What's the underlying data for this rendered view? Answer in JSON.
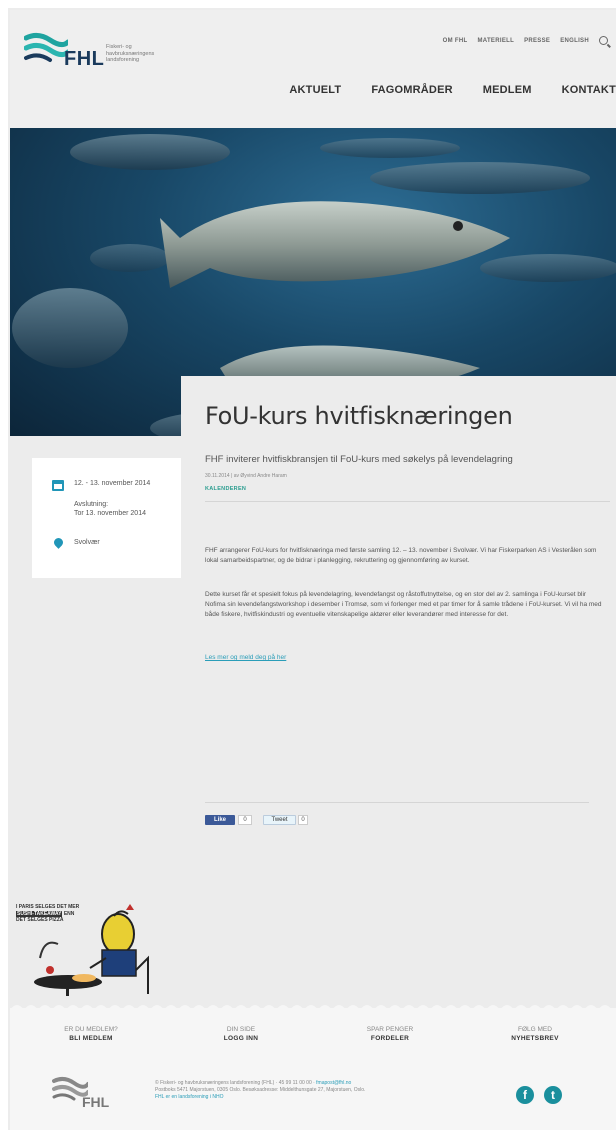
{
  "header": {
    "logo_word": "FHL",
    "logo_sub": "Fiskeri- og havbruksnæringens landsforening",
    "top_links": [
      "OM FHL",
      "MATERIELL",
      "PRESSE",
      "ENGLISH"
    ],
    "main_nav": [
      "AKTUELT",
      "FAGOMRÅDER",
      "MEDLEM",
      "KONTAKT"
    ]
  },
  "event": {
    "date": "12. - 13. november 2014",
    "deadline_label": "Avslutning:",
    "deadline_value": "Tor 13. november 2014",
    "place": "Svolvær"
  },
  "article": {
    "title": "FoU-kurs hvitfisknæringen",
    "lead": "FHF inviterer hvitfiskbransjen til FoU-kurs med søkelys på levendelagring",
    "meta": "30.11.2014 | av Øyvind Andre Haram",
    "category": "KALENDEREN",
    "p1": "FHF arrangerer FoU-kurs for hvitfisknæringa med første samling 12. – 13. november i Svolvær. Vi har Fiskerparken AS i Vesterålen som lokal samarbeidspartner, og de bidrar i planlegging, rekruttering og gjennomføring av kurset.",
    "p2": "Dette kurset får et spesielt fokus på levendelagring, levendefangst og råstoffutnyttelse, og en stor del av 2. samlinga i FoU-kurset blir Nofima sin levendefangstworkshop i desember i Tromsø, som vi forlenger med et par timer for å samle trådene i FoU-kurset. Vi vil ha med både fiskere, hvitfiskindustri og eventuelle vitenskapelige aktører eller leverandører med interesse for det.",
    "link": "Les mer og meld deg på her"
  },
  "share": {
    "fb_label": "Like",
    "fb_count": "0",
    "tw_label": "Tweet",
    "tw_count": "0"
  },
  "illustration": {
    "line1": "I PARIS SELGES DET MER",
    "line2": "SUSHI-TAKEAWAY",
    "line3": "ENN",
    "line4": "DET SELGES PIZZA"
  },
  "footer": {
    "cols": [
      {
        "q": "ER DU MEDLEM?",
        "a": "BLI MEDLEM"
      },
      {
        "q": "DIN SIDE",
        "a": "LOGG INN"
      },
      {
        "q": "SPAR PENGER",
        "a": "FORDELER"
      },
      {
        "q": "FØLG MED",
        "a": "NYHETSBREV"
      }
    ],
    "logo_word": "FHL",
    "info_line1": "© Fiskeri- og havbruksnæringens landsforening (FHL) · 45 99 11 00 00 · ",
    "info_email": "fmapost@fhl.no",
    "info_line2": "Postboks 5471 Majorstuen, 0305 Oslo. Besøksadresse: Middelthunsgate 27, Majorstuen, Oslo.",
    "info_line3": "FHL er en landsforening i NHO",
    "facebook": "f",
    "twitter": "t"
  },
  "colors": {
    "accent": "#2196b8",
    "teal": "#2a9d8f",
    "navy": "#1a3a5c"
  }
}
